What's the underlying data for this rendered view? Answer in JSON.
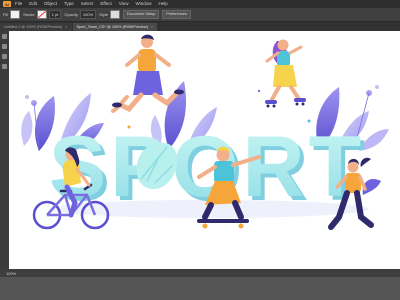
{
  "app": {
    "menu": [
      "File",
      "Edit",
      "Object",
      "Type",
      "Select",
      "Effect",
      "View",
      "Window",
      "Help"
    ]
  },
  "control_bar": {
    "fill_label": "Fill",
    "stroke_label": "Stroke",
    "stroke_value": "1 pt",
    "opacity_label": "Opacity",
    "opacity_value": "100%",
    "style_label": "Style",
    "document_setup": "Document Setup",
    "preferences": "Preferences"
  },
  "tabs": [
    {
      "label": "Untitled-1 @ 100% (RGB/Preview)",
      "active": false
    },
    {
      "label": "Sport_Team_CS* @ 100% (RGB/Preview)",
      "active": true
    }
  ],
  "artwork": {
    "headline": "SPORT"
  },
  "status": {
    "zoom": "100%"
  },
  "colors": {
    "letters": "#a8ecec",
    "letters_shadow": "#7fcfe0",
    "leaves_purple": "#7b6fe0",
    "leaves_lavender": "#b9b4f5",
    "skin": "#f2b08a",
    "orange": "#f6a53a",
    "navy": "#2f2a6b"
  }
}
